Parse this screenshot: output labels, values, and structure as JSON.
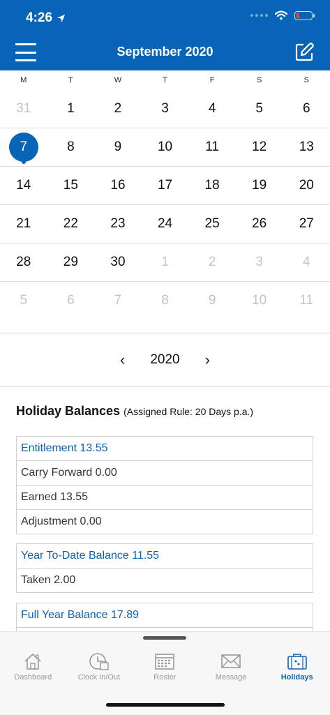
{
  "status": {
    "time": "4:26"
  },
  "header": {
    "title": "September 2020"
  },
  "weekdays": [
    "M",
    "T",
    "W",
    "T",
    "F",
    "S",
    "S"
  ],
  "calendar": {
    "weeks": [
      [
        {
          "d": "31",
          "m": true
        },
        {
          "d": "1"
        },
        {
          "d": "2"
        },
        {
          "d": "3"
        },
        {
          "d": "4"
        },
        {
          "d": "5"
        },
        {
          "d": "6"
        }
      ],
      [
        {
          "d": "7",
          "sel": true
        },
        {
          "d": "8"
        },
        {
          "d": "9"
        },
        {
          "d": "10"
        },
        {
          "d": "11"
        },
        {
          "d": "12"
        },
        {
          "d": "13"
        }
      ],
      [
        {
          "d": "14"
        },
        {
          "d": "15"
        },
        {
          "d": "16"
        },
        {
          "d": "17"
        },
        {
          "d": "18"
        },
        {
          "d": "19"
        },
        {
          "d": "20"
        }
      ],
      [
        {
          "d": "21"
        },
        {
          "d": "22"
        },
        {
          "d": "23"
        },
        {
          "d": "24"
        },
        {
          "d": "25"
        },
        {
          "d": "26"
        },
        {
          "d": "27"
        }
      ],
      [
        {
          "d": "28"
        },
        {
          "d": "29"
        },
        {
          "d": "30"
        },
        {
          "d": "1",
          "m": true
        },
        {
          "d": "2",
          "m": true
        },
        {
          "d": "3",
          "m": true
        },
        {
          "d": "4",
          "m": true
        }
      ],
      [
        {
          "d": "5",
          "m": true
        },
        {
          "d": "6",
          "m": true
        },
        {
          "d": "7",
          "m": true
        },
        {
          "d": "8",
          "m": true
        },
        {
          "d": "9",
          "m": true
        },
        {
          "d": "10",
          "m": true
        },
        {
          "d": "11",
          "m": true
        }
      ]
    ]
  },
  "year_nav": {
    "prev": "‹",
    "year": "2020",
    "next": "›"
  },
  "holiday": {
    "title": "Holiday Balances",
    "rule": "(Assigned Rule: 20 Days p.a.)",
    "cards": [
      {
        "rows": [
          "Entitlement 13.55",
          "Carry Forward 0.00",
          "Earned 13.55",
          "Adjustment 0.00"
        ]
      },
      {
        "rows": [
          "Year To-Date Balance 11.55",
          "Taken 2.00"
        ]
      },
      {
        "rows": [
          "Full Year Balance 17.89",
          ""
        ]
      }
    ]
  },
  "tabs": [
    {
      "label": "Dashboard",
      "icon": "home-icon"
    },
    {
      "label": "Clock In/Out",
      "icon": "clock-icon"
    },
    {
      "label": "Roster",
      "icon": "calendar-icon"
    },
    {
      "label": "Message",
      "icon": "mail-icon"
    },
    {
      "label": "Holidays",
      "icon": "suitcase-icon",
      "active": true
    }
  ],
  "colors": {
    "accent": "#0864b6"
  }
}
